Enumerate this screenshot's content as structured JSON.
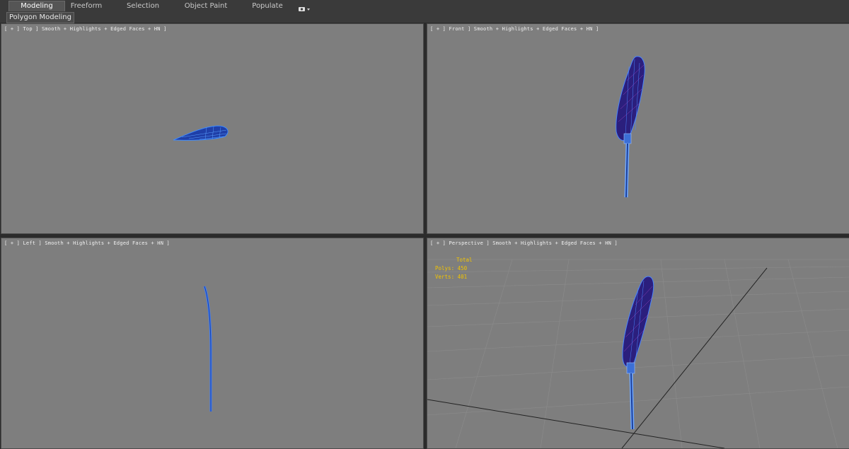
{
  "ribbon": {
    "tabs": [
      {
        "label": "Modeling",
        "active": true
      },
      {
        "label": "Freeform",
        "active": false
      },
      {
        "label": "Selection",
        "active": false
      },
      {
        "label": "Object Paint",
        "active": false
      },
      {
        "label": "Populate",
        "active": false
      }
    ],
    "extra_icon": "camera-dropdown-icon"
  },
  "subpanel": {
    "label": "Polygon Modeling"
  },
  "viewports": {
    "top": {
      "label": "[ + ] Top ] Smooth + Highlights + Edged Faces + HN ]"
    },
    "front": {
      "label": "[ + ] Front ] Smooth + Highlights + Edged Faces + HN ]"
    },
    "left": {
      "label": "[ + ] Left ] Smooth + Highlights + Edged Faces + HN ]"
    },
    "perspective": {
      "label": "[ + ] Perspective ] Smooth + Highlights + Edged Faces + HN ]"
    }
  },
  "stats": {
    "header": "Total",
    "polys_label": "Polys:",
    "polys_value": "450",
    "verts_label": "Verts:",
    "verts_value": "401"
  },
  "colors": {
    "viewport_bg": "#7e7e7e",
    "mesh_fill": "#2a1f7a",
    "mesh_wire": "#3a7bff",
    "stats_text": "#f2c400"
  }
}
